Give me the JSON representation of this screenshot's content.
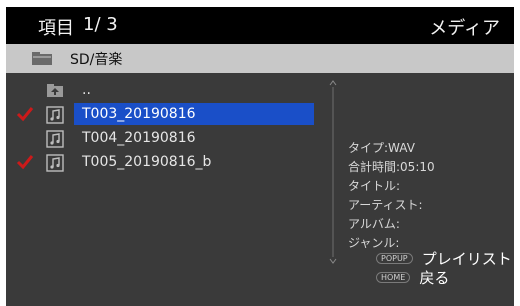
{
  "header": {
    "item_label": "項目",
    "item_position": "1/ 3",
    "mode": "メディア"
  },
  "path": {
    "folder_icon": "folder-icon",
    "text": "SD/音楽"
  },
  "files": [
    {
      "name": "..",
      "icon": "parent-folder-icon",
      "checked": false,
      "selected": false
    },
    {
      "name": "T003_20190816",
      "icon": "music-note-icon",
      "checked": true,
      "selected": true
    },
    {
      "name": "T004_20190816",
      "icon": "music-note-icon",
      "checked": false,
      "selected": false
    },
    {
      "name": "T005_20190816_b",
      "icon": "music-note-icon",
      "checked": true,
      "selected": false
    }
  ],
  "info": {
    "type": "タイプ:WAV",
    "total_time": "合計時間:05:10",
    "title": "タイトル:",
    "artist": "アーティスト:",
    "album": "アルバム:",
    "genre": "ジャンル:"
  },
  "hints": [
    {
      "key": "POPUP",
      "action": "プレイリスト"
    },
    {
      "key": "HOME",
      "action": "戻る"
    }
  ],
  "colors": {
    "selection": "#1a4fc8",
    "checkmark": "#cc1a1a",
    "background": "#3a3a3a"
  }
}
